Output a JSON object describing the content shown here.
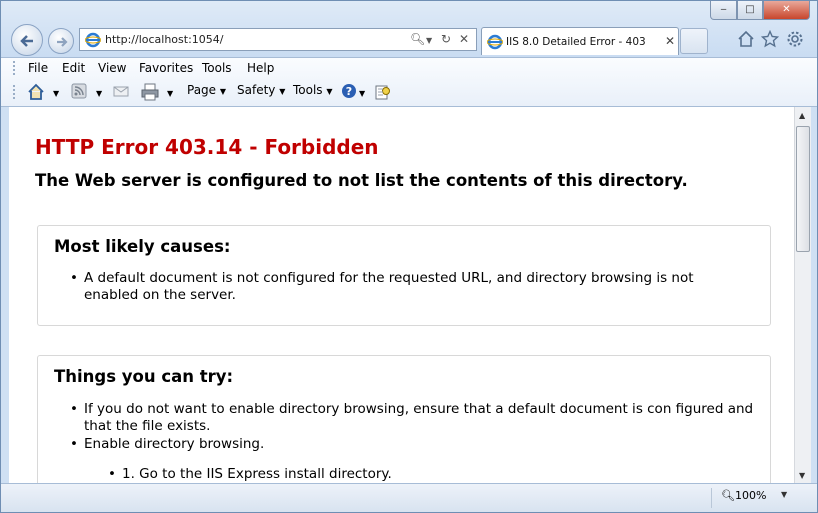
{
  "window": {
    "min_label": "‒",
    "max_label": "□",
    "close_label": "✕"
  },
  "nav": {
    "address": "http://localhost:1054/",
    "tab_title": "IIS 8.0 Detailed Error - 403.1..."
  },
  "menu": [
    "File",
    "Edit",
    "View",
    "Favorites",
    "Tools",
    "Help"
  ],
  "command_bar": {
    "page": "Page",
    "safety": "Safety",
    "tools": "Tools"
  },
  "page": {
    "title": "HTTP Error 403.14 - Forbidden",
    "subtitle": "The Web server is configured to not list the contents of this directory.",
    "causes_heading": "Most likely causes:",
    "causes": [
      "A default document is not configured for the requested URL, and directory browsing is not enabled on the server."
    ],
    "try_heading": "Things you can try:",
    "try_items": [
      "If you do not want to enable directory browsing, ensure that a default document is con figured and that the file exists.",
      "Enable directory browsing."
    ],
    "steps": [
      "1.  Go to the IIS Express install directory."
    ]
  },
  "status": {
    "zoom": "100%"
  },
  "colors": {
    "error_red": "#c00000",
    "frame": "#cfe0f3"
  }
}
